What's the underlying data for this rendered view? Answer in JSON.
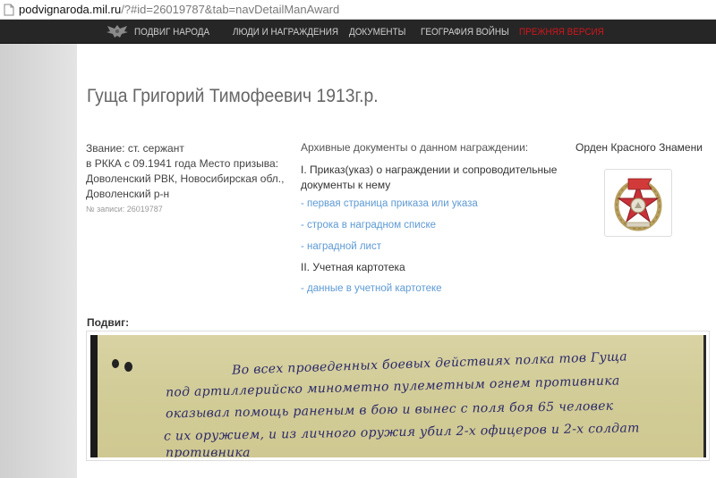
{
  "browser": {
    "url_domain": "podvignaroda.mil.ru",
    "url_rest": "/?#id=26019787&tab=navDetailManAward"
  },
  "nav": {
    "items": [
      "ПОДВИГ НАРОДА",
      "ЛЮДИ И НАГРАЖДЕНИЯ",
      "ДОКУМЕНТЫ",
      "ГЕОГРАФИЯ ВОЙНЫ",
      "ПРЕЖНЯЯ ВЕРСИЯ"
    ],
    "old_version_color": "#d0161c"
  },
  "person": {
    "title": "Гуща Григорий Тимофеевич 1913г.р.",
    "rank_line": "Звание: ст. сержант",
    "service_lines": [
      "в РККА с 09.1941 года Место призыва:",
      "Доволенский РВК, Новосибирская обл.,",
      "Доволенский р-н"
    ],
    "record_number": "№ записи: 26019787"
  },
  "documents": {
    "heading": "Архивные документы о данном награждении:",
    "section1_title": "I. Приказ(указ) о награждении и сопроводительные документы к нему",
    "section1_links": [
      "- первая страница приказа или указа",
      "- строка в наградном списке",
      "- наградной лист"
    ],
    "section2_title": "II. Учетная картотека",
    "section2_links": [
      "- данные в учетной картотеке"
    ],
    "link_color": "#5e9ad3"
  },
  "award": {
    "name": "Орден Красного Знамени",
    "image_icon": "order-red-banner-icon"
  },
  "feat": {
    "label": "Подвиг:",
    "handwritten_lines": [
      "Во всех проведенных боевых действиях полка тов Гуща",
      "под артиллерийско минометно пулеметным огнем противника",
      "оказывал помощь раненым в бою и вынес с поля боя 65 человек",
      "с их оружием, и из личного оружия убил 2-х офицеров и 2-х солдат",
      "противника"
    ]
  }
}
